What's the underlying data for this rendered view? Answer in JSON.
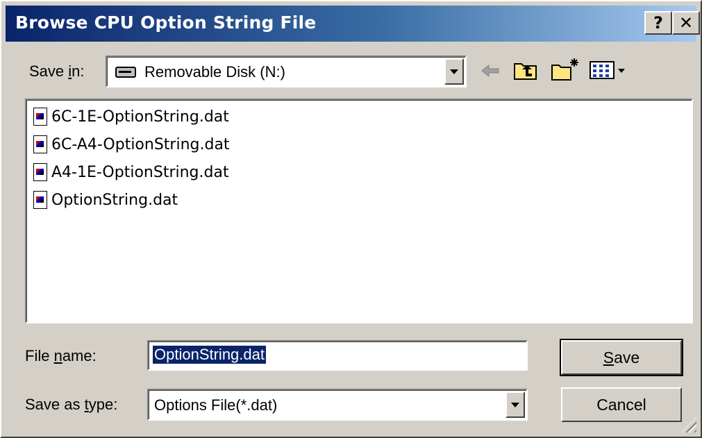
{
  "window": {
    "title": "Browse CPU Option String File",
    "help_label": "?",
    "close_label": "✕"
  },
  "save_in": {
    "label_prefix": "Save ",
    "label_underlined": "i",
    "label_suffix": "n:",
    "value": "Removable Disk (N:)"
  },
  "toolbar": {
    "icons": [
      "back-arrow-icon",
      "up-one-level-icon",
      "new-folder-icon",
      "view-menu-icon"
    ]
  },
  "files": [
    {
      "name": "6C-1E-OptionString.dat"
    },
    {
      "name": "6C-A4-OptionString.dat"
    },
    {
      "name": "A4-1E-OptionString.dat"
    },
    {
      "name": "OptionString.dat"
    }
  ],
  "file_name": {
    "label_prefix": "File ",
    "label_underlined": "n",
    "label_suffix": "ame:",
    "value": "OptionString.dat"
  },
  "save_as_type": {
    "label_prefix": "Save as ",
    "label_underlined": "t",
    "label_suffix": "ype:",
    "value": "Options File(*.dat)"
  },
  "buttons": {
    "save_underlined": "S",
    "save_rest": "ave",
    "cancel": "Cancel"
  },
  "colors": {
    "title_bar_start": "#0a246a",
    "title_bar_end": "#a6caf0",
    "dialog_face": "#d4d0c8",
    "selection": "#0a246a"
  }
}
